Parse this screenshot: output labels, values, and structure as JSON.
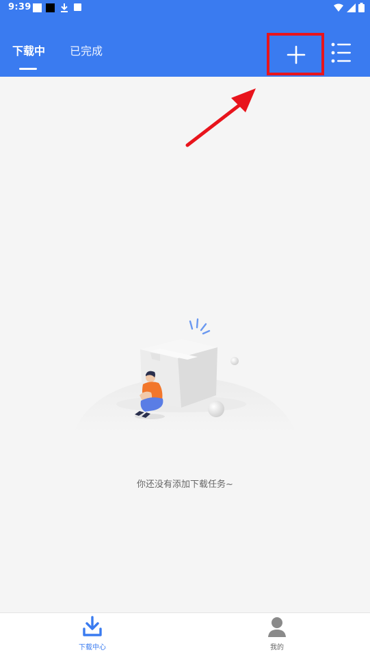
{
  "status_bar": {
    "time": "9:39",
    "left_icons": [
      "notification-square-icon",
      "notification-black-icon",
      "download-icon",
      "app-icon"
    ],
    "right_icons": [
      "wifi-icon",
      "signal-icon",
      "battery-icon"
    ]
  },
  "header": {
    "background": "#3a7bf0",
    "tabs": [
      {
        "label": "下载中",
        "active": true
      },
      {
        "label": "已完成",
        "active": false
      }
    ],
    "actions": [
      "add-icon",
      "list-menu-icon"
    ]
  },
  "annotation": {
    "highlight_color": "#e8141c",
    "arrow_color": "#e8141c"
  },
  "empty_state": {
    "message": "你还没有添加下载任务~"
  },
  "bottom_nav": {
    "items": [
      {
        "label": "下载中心",
        "icon": "download-icon",
        "active": true
      },
      {
        "label": "我的",
        "icon": "user-icon",
        "active": false
      }
    ],
    "active_color": "#3a7bf0"
  }
}
